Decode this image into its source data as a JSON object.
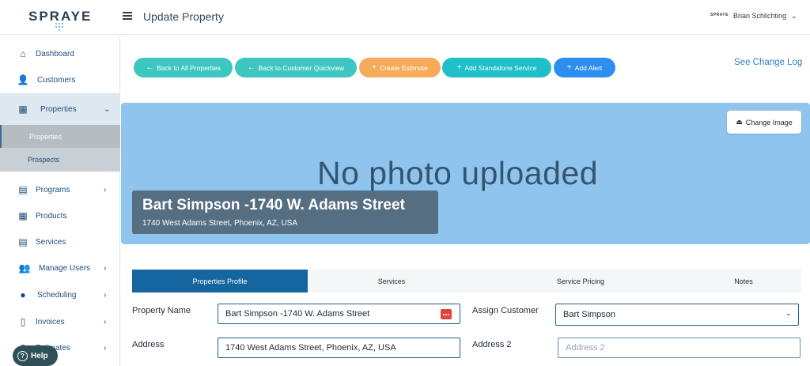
{
  "brand": {
    "logo": "SPRAYE",
    "small_logo": "SPRAYE"
  },
  "header": {
    "title": "Update Property",
    "user_name": "Brian Schlichting"
  },
  "sidebar": {
    "items": [
      {
        "label": "Dashboard",
        "icon": "home-icon"
      },
      {
        "label": "Customers",
        "icon": "user-icon"
      },
      {
        "label": "Properties",
        "icon": "building-icon"
      },
      {
        "label": "Programs",
        "icon": "calendar-icon"
      },
      {
        "label": "Products",
        "icon": "grid-icon"
      },
      {
        "label": "Services",
        "icon": "list-icon"
      },
      {
        "label": "Manage Users",
        "icon": "users-icon"
      },
      {
        "label": "Scheduling",
        "icon": "location-pin-icon"
      },
      {
        "label": "Invoices",
        "icon": "document-icon"
      },
      {
        "label": "Estimates",
        "icon": "estimate-icon"
      }
    ],
    "sub_items": [
      {
        "label": "Properties"
      },
      {
        "label": "Prospects"
      }
    ]
  },
  "help": {
    "label": "Help"
  },
  "actions": {
    "back_all": "Back to All Properties",
    "back_customer": "Back to Customer Quickview",
    "create_estimate": "Create Estimate",
    "add_service": "Add Standalone Service",
    "add_alert": "Add Alert",
    "change_log": "See Change Log"
  },
  "banner": {
    "placeholder": "No photo uploaded",
    "change_image": "Change Image",
    "property_title": "Bart Simpson -1740 W. Adams Street",
    "property_address": "1740 West Adams Street, Phoenix, AZ, USA"
  },
  "tabs": [
    {
      "label": "Properties Profile",
      "active": true
    },
    {
      "label": "Services",
      "active": false
    },
    {
      "label": "Service Pricing",
      "active": false
    },
    {
      "label": "Notes",
      "active": false
    }
  ],
  "form": {
    "property_name_label": "Property Name",
    "property_name_value": "Bart  Simpson -1740 W. Adams Street",
    "assign_customer_label": "Assign Customer",
    "assign_customer_value": "Bart Simpson",
    "address_label": "Address",
    "address_value": "1740 West Adams Street, Phoenix, AZ, USA",
    "address2_label": "Address 2",
    "address2_placeholder": "Address 2"
  },
  "colors": {
    "accent_teal": "#3ec7c0",
    "accent_orange": "#f6ab5b",
    "accent_blue": "#2c8fef",
    "tab_active": "#1565a0",
    "banner": "#8ec4ee"
  }
}
